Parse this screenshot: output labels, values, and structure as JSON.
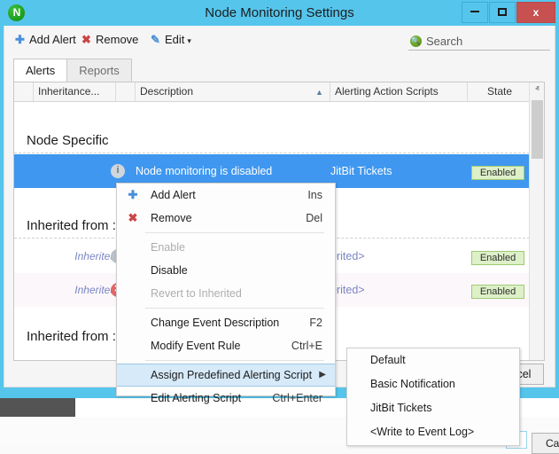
{
  "window": {
    "title": "Node Monitoring Settings",
    "logo_glyph": "N",
    "minimize_label": "",
    "maximize_label": "",
    "close_label": "x"
  },
  "toolbar": {
    "add_alert": "Add Alert",
    "add_alert_icon": "plus-icon",
    "remove": "Remove",
    "remove_icon": "x-icon",
    "edit": "Edit",
    "edit_icon": "pencil-icon",
    "edit_caret": "▾",
    "search_placeholder": "Search",
    "search_value": "Search",
    "search_icon": "search-icon"
  },
  "tabs": [
    {
      "label": "Alerts",
      "active": true
    },
    {
      "label": "Reports",
      "active": false
    }
  ],
  "grid": {
    "columns": [
      {
        "key": "blank",
        "label": ""
      },
      {
        "key": "inheritance",
        "label": "Inheritance..."
      },
      {
        "key": "gap",
        "label": ""
      },
      {
        "key": "description",
        "label": "Description",
        "sorted": true,
        "sort_arrow": "▲"
      },
      {
        "key": "scripts",
        "label": "Alerting Action Scripts"
      },
      {
        "key": "state",
        "label": "State"
      }
    ],
    "groups": [
      {
        "header": "Node Specific",
        "rows": [
          {
            "inheritance": "",
            "icon": "info-icon",
            "description": "Node monitoring is disabled",
            "scripts": "JitBit Tickets",
            "state": "Enabled",
            "selected": true
          }
        ]
      },
      {
        "header": "Inherited from :",
        "rows": [
          {
            "inheritance": "Inherited",
            "icon": "info-icon",
            "description": "",
            "scripts": "erited>",
            "state": "Enabled",
            "selected": false
          },
          {
            "inheritance": "Inherited",
            "icon": "error-icon",
            "description": "",
            "scripts": "erited>",
            "state": "Enabled",
            "selected": false
          }
        ]
      },
      {
        "header": "Inherited from :",
        "rows": []
      }
    ]
  },
  "scrollbar": {
    "up_arrow": "ⱏ",
    "down_arrow": "ⱟ"
  },
  "footer": {
    "ok_label": "",
    "cancel_label": "Cancel"
  },
  "context_menu": {
    "items": [
      {
        "label": "Add Alert",
        "accel": "Ins",
        "icon": "plus-icon",
        "icon_glyph": "＋",
        "icon_color": "#4a90d9",
        "disabled": false,
        "highlight": false,
        "submenu": false
      },
      {
        "label": "Remove",
        "accel": "Del",
        "icon": "x-icon",
        "icon_glyph": "✖",
        "icon_color": "#cc4444",
        "disabled": false,
        "highlight": false,
        "submenu": false
      },
      {
        "separator": true
      },
      {
        "label": "Enable",
        "accel": "",
        "icon": "",
        "disabled": true,
        "highlight": false,
        "submenu": false
      },
      {
        "label": "Disable",
        "accel": "",
        "icon": "",
        "disabled": false,
        "highlight": false,
        "submenu": false
      },
      {
        "label": "Revert to Inherited",
        "accel": "",
        "icon": "",
        "disabled": true,
        "highlight": false,
        "submenu": false
      },
      {
        "separator": true
      },
      {
        "label": "Change Event Description",
        "accel": "F2",
        "icon": "",
        "disabled": false,
        "highlight": false,
        "submenu": false
      },
      {
        "label": "Modify Event Rule",
        "accel": "Ctrl+E",
        "icon": "",
        "disabled": false,
        "highlight": false,
        "submenu": false
      },
      {
        "separator": true
      },
      {
        "label": "Assign Predefined Alerting Script",
        "accel": "",
        "icon": "",
        "disabled": false,
        "highlight": true,
        "submenu": true,
        "submenu_arrow": "▶"
      },
      {
        "label": "Edit Alerting Script",
        "accel": "Ctrl+Enter",
        "icon": "",
        "disabled": false,
        "highlight": false,
        "submenu": false
      }
    ]
  },
  "submenu": {
    "items": [
      {
        "label": "Default"
      },
      {
        "label": "Basic Notification"
      },
      {
        "label": "JitBit Tickets"
      },
      {
        "label": "<Write to Event Log>"
      }
    ]
  },
  "background": {
    "cancel_label": "Canc"
  },
  "colors": {
    "title_bar": "#55c5ec",
    "selection": "#3f97f0",
    "close_button": "#c75050",
    "badge_bg": "#ddf0c8",
    "badge_border": "#9fca74",
    "inherited_text": "#7b86c4",
    "menu_highlight": "#d6eaf9"
  }
}
